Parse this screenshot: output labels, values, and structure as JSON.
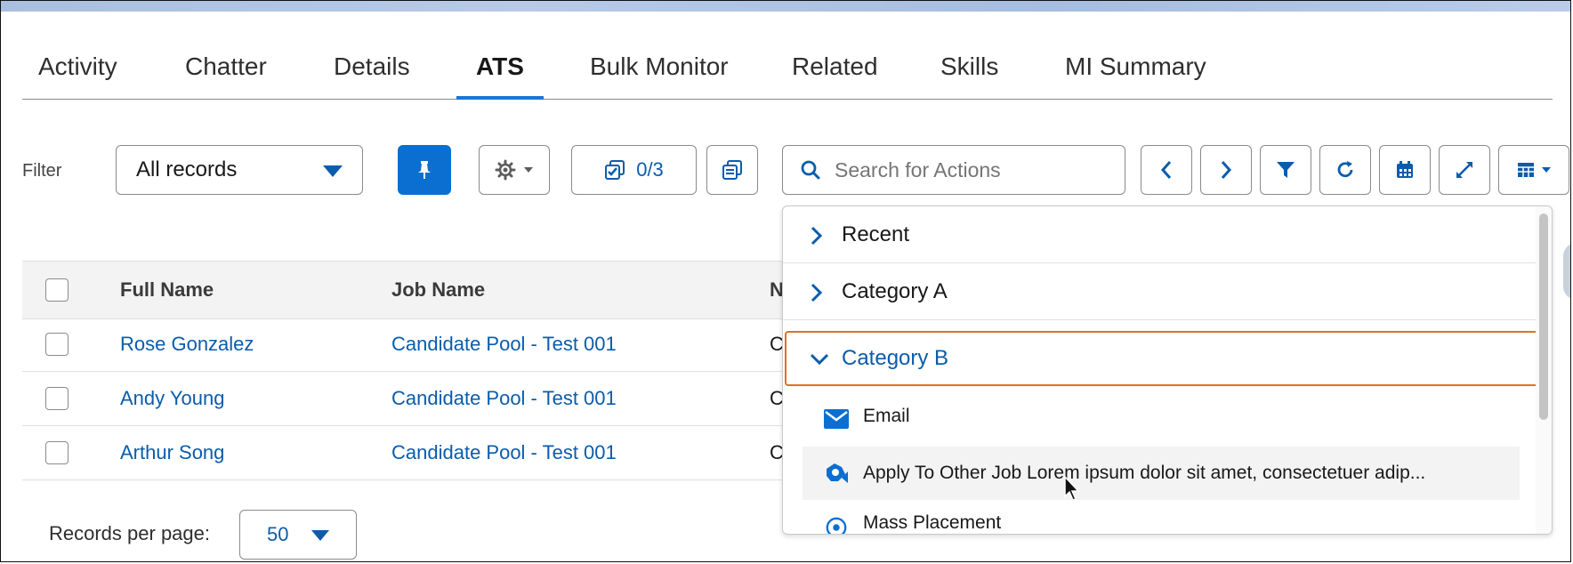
{
  "tabs": [
    {
      "label": "Activity"
    },
    {
      "label": "Chatter"
    },
    {
      "label": "Details"
    },
    {
      "label": "ATS"
    },
    {
      "label": "Bulk Monitor"
    },
    {
      "label": "Related"
    },
    {
      "label": "Skills"
    },
    {
      "label": "MI Summary"
    }
  ],
  "active_tab": "ATS",
  "toolbar": {
    "filter_label": "Filter",
    "filter_value": "All records",
    "selected_count": "0/3",
    "search_placeholder": "Search for Actions"
  },
  "table": {
    "columns": [
      "Full Name",
      "Job Name",
      "N"
    ],
    "rows": [
      {
        "full_name": "Rose Gonzalez",
        "job_name": "Candidate Pool - Test 001",
        "next": "C"
      },
      {
        "full_name": "Andy Young",
        "job_name": "Candidate Pool - Test 001",
        "next": "C"
      },
      {
        "full_name": "Arthur Song",
        "job_name": "Candidate Pool - Test 001",
        "next": "C"
      }
    ]
  },
  "pagination": {
    "records_per_page_label": "Records per page:",
    "records_per_page_value": "50"
  },
  "action_menu": {
    "sections": [
      {
        "label": "Recent",
        "expanded": false
      },
      {
        "label": "Category A",
        "expanded": false
      },
      {
        "label": "Category B",
        "expanded": true
      }
    ],
    "items": [
      {
        "label": "Email",
        "icon": "email-icon"
      },
      {
        "label": "Apply To Other Job Lorem ipsum dolor sit amet, consectetuer adip...",
        "icon": "apply-job-icon"
      },
      {
        "label": "Mass Placement",
        "icon": "placement-icon"
      }
    ]
  },
  "colors": {
    "brand_blue": "#0b6fd1",
    "link_blue": "#0b5cab",
    "focus_orange": "#e2701f"
  }
}
